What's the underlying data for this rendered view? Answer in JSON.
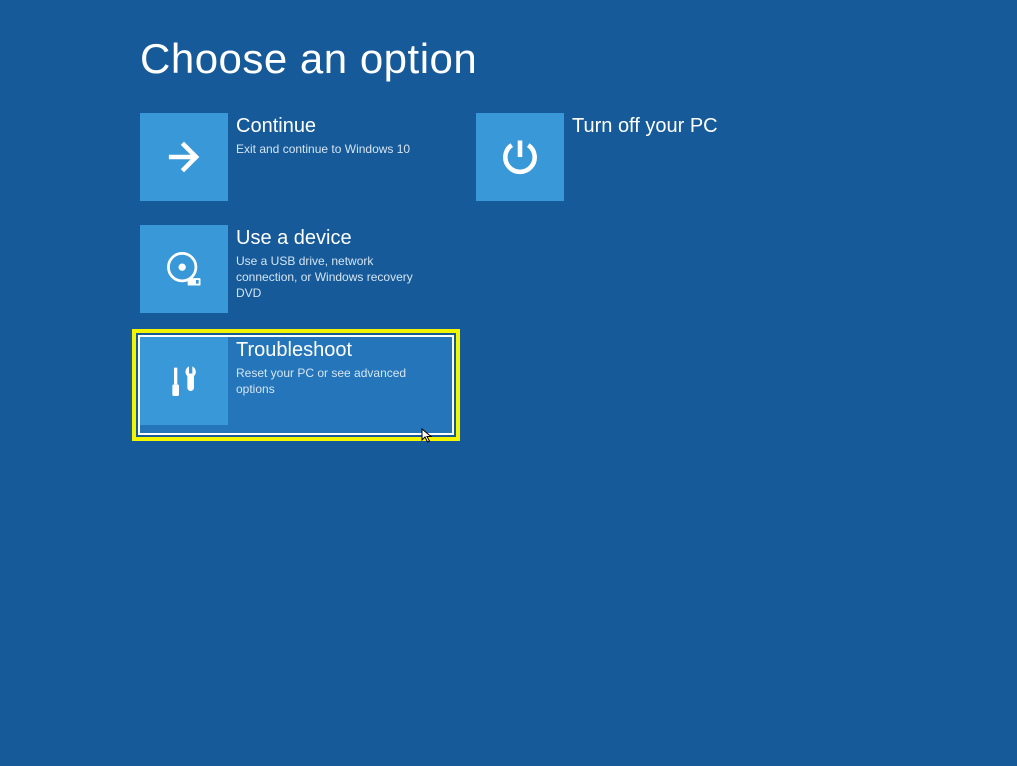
{
  "page": {
    "title": "Choose an option"
  },
  "options": {
    "continue": {
      "title": "Continue",
      "subtitle": "Exit and continue to Windows 10"
    },
    "turnoff": {
      "title": "Turn off your PC",
      "subtitle": ""
    },
    "usedevice": {
      "title": "Use a device",
      "subtitle": "Use a USB drive, network connection, or Windows recovery DVD"
    },
    "troubleshoot": {
      "title": "Troubleshoot",
      "subtitle": "Reset your PC or see advanced options"
    }
  },
  "colors": {
    "background": "#165a99",
    "tile_icon_bg": "#3898d8",
    "highlight_border": "#f3f500",
    "highlight_bg": "#2475b9"
  }
}
